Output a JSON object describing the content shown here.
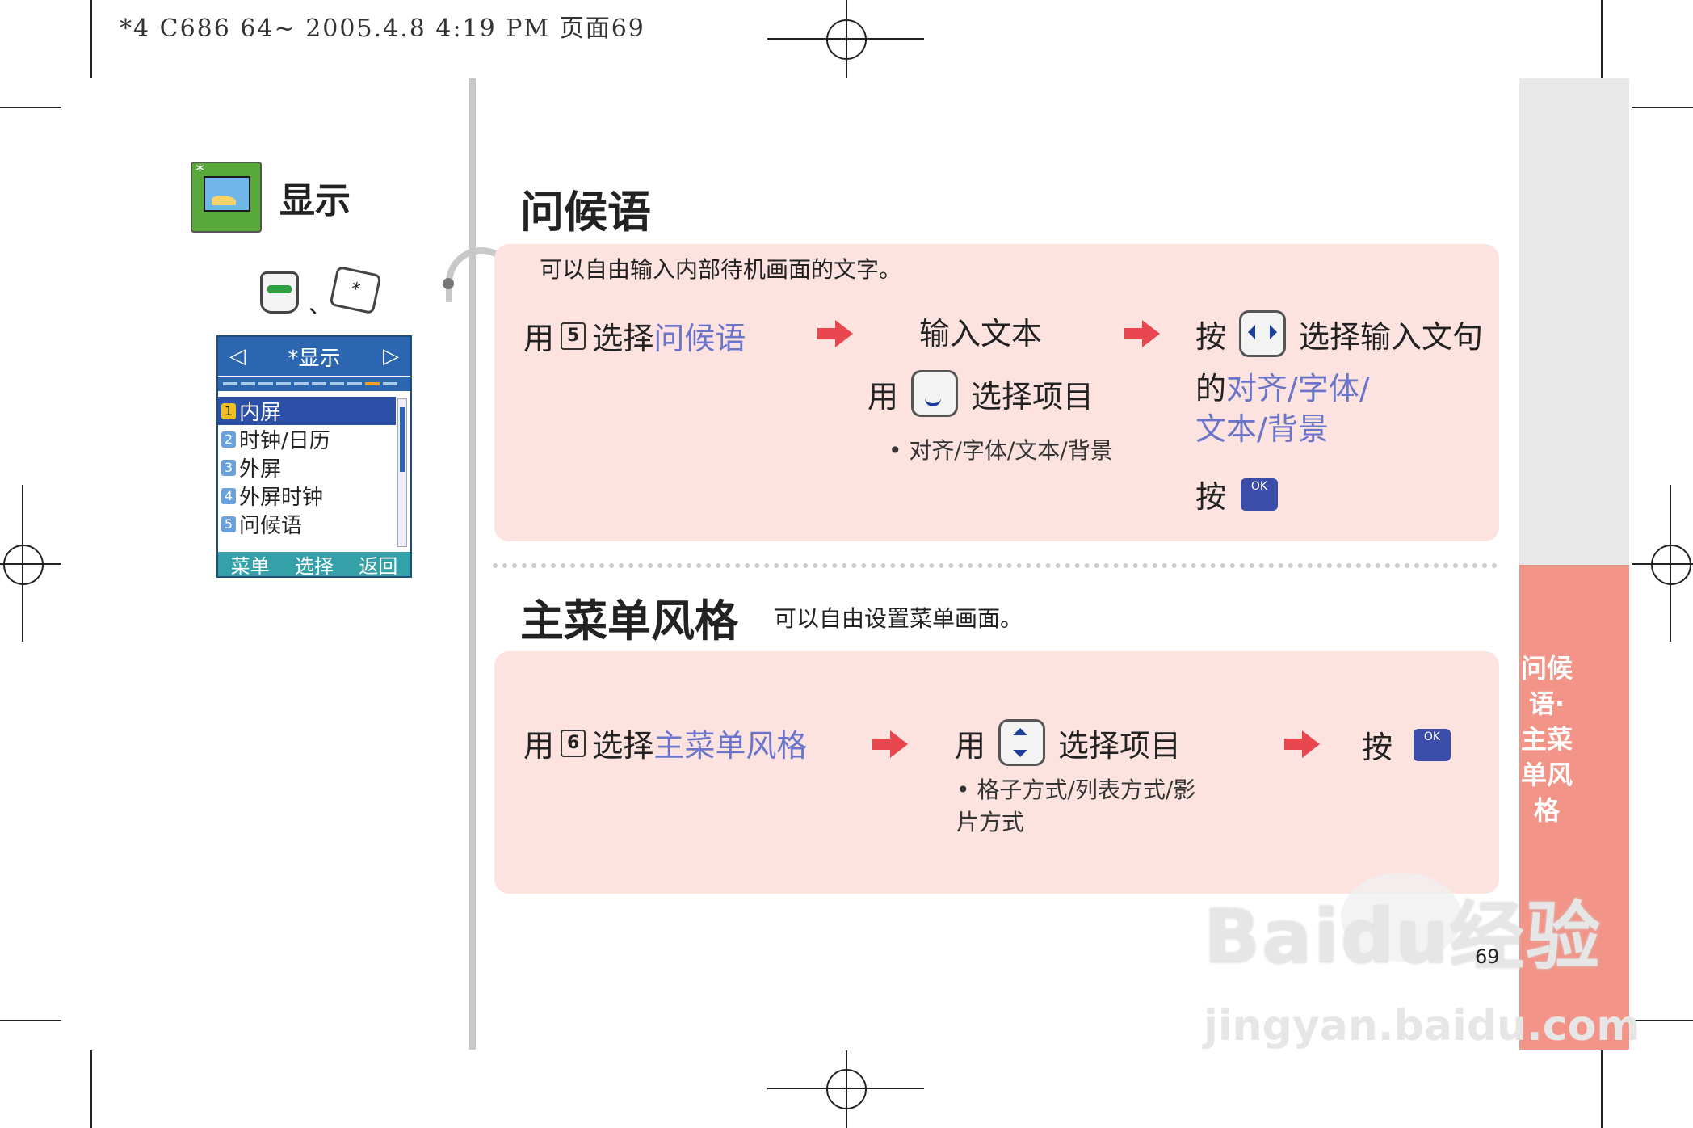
{
  "print_header": "*4 C686 64~  2005.4.8 4:19 PM  页面69",
  "left_panel": {
    "title": "显示",
    "separator": "、",
    "star_key": "*",
    "phone": {
      "header": "*显示",
      "left_arrow": "◁",
      "right_arrow": "▷",
      "items": [
        {
          "num": "1",
          "label": "内屏"
        },
        {
          "num": "2",
          "label": "时钟/日历"
        },
        {
          "num": "3",
          "label": "外屏"
        },
        {
          "num": "4",
          "label": "外屏时钟"
        },
        {
          "num": "5",
          "label": "问候语"
        }
      ],
      "softkeys": [
        "菜单",
        "选择",
        "返回"
      ]
    }
  },
  "section1": {
    "title": "问候语",
    "desc": "可以自由输入内部待机画面的文字。",
    "use": "用",
    "key": "5",
    "select_prefix": "选择",
    "select_target": "问候语",
    "input_text": "输入文本",
    "use2": "用",
    "select_item": "选择项目",
    "options": "• 对齐/字体/文本/背景",
    "press": "按",
    "select_sentence": "选择输入文句",
    "of": "的",
    "targets_line1": "对齐/字体/",
    "targets_line2": "文本/背景",
    "press2": "按",
    "ok": "OK"
  },
  "section2": {
    "title": "主菜单风格",
    "desc": "可以自由设置菜单画面。",
    "use": "用",
    "key": "6",
    "select_prefix": "选择",
    "select_target": "主菜单风格",
    "use2": "用",
    "select_item": "选择项目",
    "options": "• 格子方式/列表方式/影片方式",
    "press": "按",
    "ok": "OK"
  },
  "side_tab": "问候语·主菜单风格",
  "page_number": "69",
  "watermark": {
    "main": "Baidu经验",
    "url": "jingyan.baidu.com"
  },
  "colors": {
    "accent_red": "#e8474f",
    "link_blue": "#6a74c8",
    "box_pink": "#fce3df",
    "tab_pink": "#f29487"
  }
}
